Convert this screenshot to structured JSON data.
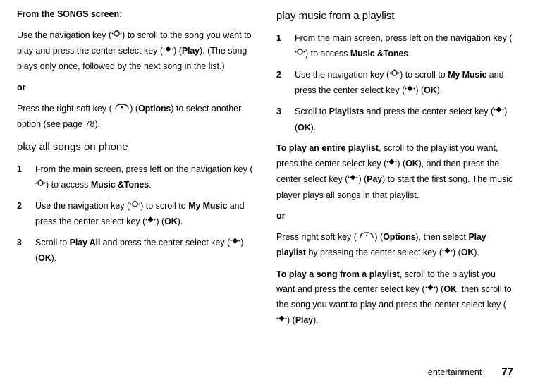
{
  "left": {
    "intro_bold": "From the ",
    "intro_songs": "SONGS",
    "intro_bold2": " screen",
    "intro_colon": ":",
    "p1a": "Use the navigation key (",
    "p1b": ") to scroll to the song you want to play and press the center select key (",
    "p1c": ") (",
    "p1_play": "Play",
    "p1d": "). (The song plays only once, followed by the next song in the list.)",
    "or": "or",
    "p2a": "Press the right soft key ( ",
    "p2b": ") (",
    "p2_options": "Options",
    "p2c": ") to select another option (see page 78).",
    "h1": "play all songs on phone",
    "s1": {
      "a": "From the main screen, press left on the navigation key (",
      "b": ") to access ",
      "mt": "Music &Tones",
      "c": "."
    },
    "s2": {
      "a": "Use the navigation key (",
      "b": ") to scroll to ",
      "mm": "My Music",
      "c": " and press the center select key (",
      "d": ") (",
      "ok": "OK",
      "e": ")."
    },
    "s3": {
      "a": "Scroll to ",
      "pa": "Play All",
      "b": " and press the center select key (",
      "c": ") (",
      "ok": "OK",
      "d": ")."
    }
  },
  "right": {
    "h1": "play music from a playlist",
    "s1": {
      "a": "From the main screen, press left on the navigation key (",
      "b": ") to access ",
      "mt": "Music &Tones",
      "c": "."
    },
    "s2": {
      "a": "Use the navigation key (",
      "b": ") to scroll to ",
      "mm": "My Music",
      "c": " and press the center select key (",
      "d": ") (",
      "ok": "OK",
      "e": ")."
    },
    "s3": {
      "a": "Scroll to ",
      "pl": "Playlists",
      "b": " and press the center select key (",
      "c": ") (",
      "ok": "OK",
      "d": ")."
    },
    "p1_bold": "To play an entire playlist",
    "p1a": ", scroll to the playlist you want, press the center select key (",
    "p1b": ") (",
    "p1_ok": "OK",
    "p1c": "), and then press the center select key (",
    "p1d": ") (",
    "p1_pay": "Pay",
    "p1e": ") to start the first song. The music player plays all songs in that playlist.",
    "or": "or",
    "p2a": "Press right soft key  ( ",
    "p2b": ") (",
    "p2_options": "Options",
    "p2c": "), then select ",
    "p2_pp": "Play playlist",
    "p2d": " by pressing the center select key (",
    "p2e": ") (",
    "p2_ok": "OK",
    "p2f": ").",
    "p3_bold": "To play a song from a playlist",
    "p3a": ", scroll to the playlist you want and press the center select key (",
    "p3b": ") (",
    "p3_ok": "OK",
    "p3c": ", then scroll to the song you want to play and press the center select key (",
    "p3d": ") (",
    "p3_play": "Play",
    "p3e": ")."
  },
  "footer": {
    "label": "entertainment",
    "page": "77"
  }
}
